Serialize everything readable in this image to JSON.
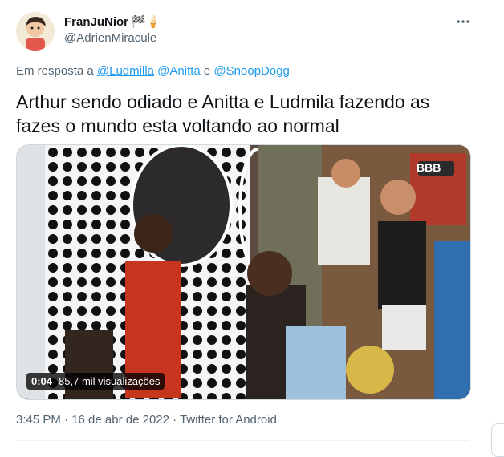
{
  "author": {
    "display_name": "FranJuNior",
    "badge_emojis": "🏁🍦",
    "handle": "@AdrienMiracule"
  },
  "reply_to": {
    "prefix": "Em resposta a",
    "mentions": [
      "@Ludmilla",
      "@Anitta",
      "@SnoopDogg"
    ],
    "conjunction": "e"
  },
  "tweet": {
    "text": "Arthur sendo odiado e Anitta e Ludmila fazendo as fazes o mundo esta voltando ao normal",
    "timestamp": "3:45 PM · 16 de abr de 2022 · Twitter for Android"
  },
  "media": {
    "overlay_label": "BBB",
    "duration": "0:04",
    "views": "85,7 mil visualizações"
  },
  "icons": {
    "more": "more-options-icon"
  },
  "colors": {
    "link": "#1d9bf0",
    "secondary_text": "#536471",
    "primary_text": "#0f1419"
  }
}
